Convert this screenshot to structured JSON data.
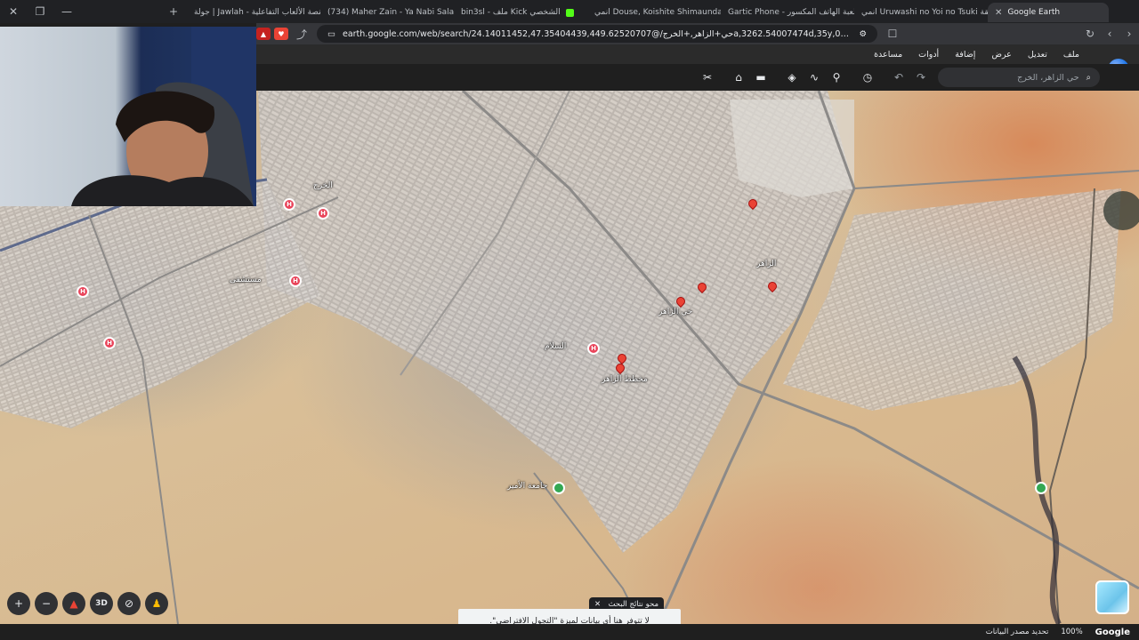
{
  "browser": {
    "tabs": [
      {
        "label": "Google Earth",
        "active": true,
        "fav_color": "#4285f4"
      },
      {
        "label": "انمي Uruwashi no Yoi no Tsuki الحلقة",
        "fav_color": "#e9445a"
      },
      {
        "label": "Gartic Phone - لعبة الهاتف المكسور",
        "fav_color": "#7c4dff"
      },
      {
        "label": "انمي Douse, Koishite Shimaunda ال",
        "fav_color": "#e9445a"
      },
      {
        "label": "bin3sl - ملف Kick الشخصي",
        "fav_color": "#53fc18"
      },
      {
        "label": "(734) Maher Zain - Ya Nabi Salam Al",
        "fav_color": "#ff0000"
      },
      {
        "label": "جولة | Jawlah - منصة الألعاب التفاعلية",
        "fav_color": "#ffffff"
      }
    ],
    "url": "earth.google.com/web/search/حي+الزاهر,+الخرج/@24.14011452,47.35404439,449.62520707a,3262.54007474d,35y,0h,0t,0r/data=CiwiJgokCXKe..."
  },
  "menubar": {
    "items": [
      "ملف",
      "تعديل",
      "عرض",
      "إضافة",
      "أدوات",
      "مساعدة"
    ]
  },
  "toolbar": {
    "search_placeholder": "حي الزاهر، الخرج",
    "icons": [
      "search-icon",
      "redo-icon",
      "undo-icon",
      "history-icon",
      "place-pin-icon",
      "path-icon",
      "layers-icon",
      "ruler-icon",
      "screenshot-icon",
      "measure-icon"
    ]
  },
  "map": {
    "labels": [
      {
        "text": "الخرج",
        "kind": "hospital"
      },
      {
        "text": "مستشفى",
        "kind": "hospital"
      },
      {
        "text": "حي الزاهر",
        "kind": "district"
      },
      {
        "text": "جامعة الأمير",
        "kind": "poi"
      },
      {
        "text": "الزاهر",
        "kind": "district"
      },
      {
        "text": "مخطط الزاهر",
        "kind": "district"
      },
      {
        "text": "السلام",
        "kind": "district"
      }
    ]
  },
  "toast": {
    "title": "محو نتائج البحث",
    "message": "لا تتوفر هنا أي بيانات لميزة \"التجول الافتراضي\"."
  },
  "controls": {
    "zoom_in": "+",
    "zoom_out": "−",
    "three_d": "3D"
  },
  "status": {
    "attribution": "Google",
    "zoom": "100%",
    "data_source": "تحديد مصدر البيانات"
  },
  "colors": {
    "accent": "#1a73e8",
    "hospital_pin": "#e9445a",
    "place_pin": "#ea4335",
    "park_pin": "#34a853"
  }
}
